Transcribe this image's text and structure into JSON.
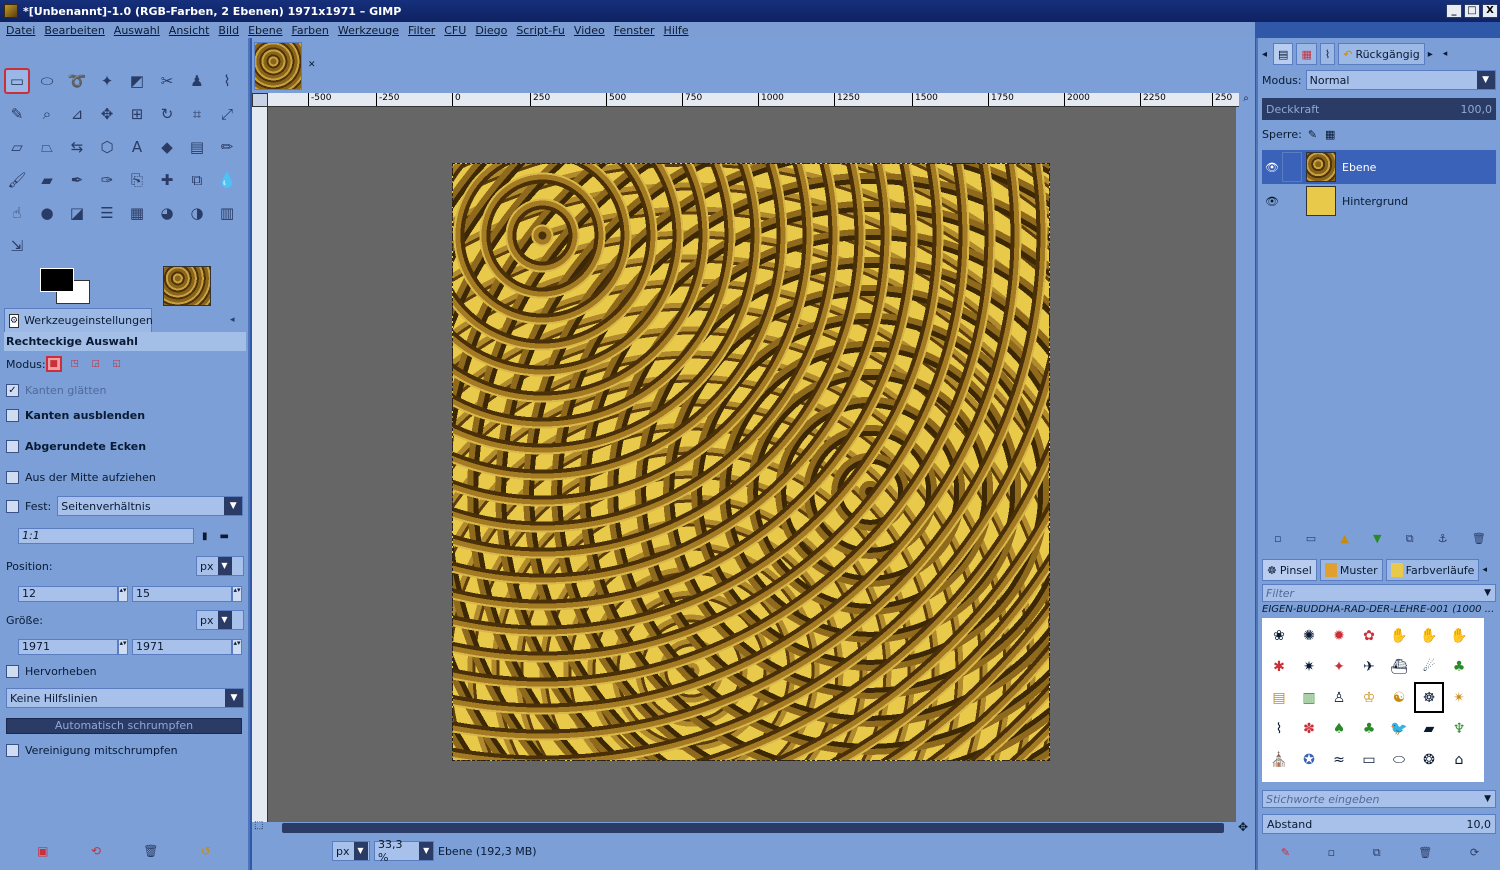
{
  "window": {
    "title": "*[Unbenannt]-1.0 (RGB-Farben, 2 Ebenen) 1971x1971 – GIMP",
    "minimize": "_",
    "maximize": "□",
    "close": "X"
  },
  "menu": [
    "Datei",
    "Bearbeiten",
    "Auswahl",
    "Ansicht",
    "Bild",
    "Ebene",
    "Farben",
    "Werkzeuge",
    "Filter",
    "CFU",
    "Diego",
    "Script-Fu",
    "Video",
    "Fenster",
    "Hilfe"
  ],
  "tool_options": {
    "tab_label": "Werkzeugeinstellungen",
    "tool_name": "Rechteckige Auswahl",
    "mode_label": "Modus:",
    "antialias": {
      "label": "Kanten glätten",
      "checked": true
    },
    "feather": {
      "label": "Kanten ausblenden",
      "checked": false
    },
    "rounded": {
      "label": "Abgerundete Ecken",
      "checked": false
    },
    "from_center": {
      "label": "Aus der Mitte aufziehen",
      "checked": false
    },
    "fixed": {
      "label": "Fest:",
      "value": "Seitenverhältnis",
      "checked": false
    },
    "ratio_value": "1:1",
    "position": {
      "label": "Position:",
      "unit": "px",
      "x": "12",
      "y": "15"
    },
    "size": {
      "label": "Größe:",
      "unit": "px",
      "w": "1971",
      "h": "1971"
    },
    "highlight": {
      "label": "Hervorheben",
      "checked": false
    },
    "guides": "Keine Hilfslinien",
    "auto_shrink": "Automatisch schrumpfen",
    "shrink_merged": {
      "label": "Vereinigung mitschrumpfen",
      "checked": false
    }
  },
  "ruler_ticks": [
    "-500",
    "-250",
    "0",
    "250",
    "500",
    "750",
    "1000",
    "1250",
    "1500",
    "1750",
    "2000",
    "2250",
    "250"
  ],
  "status": {
    "unit": "px",
    "zoom": "33,3 %",
    "info": "Ebene (192,3 MB)"
  },
  "layers_panel": {
    "undo_tab": "Rückgängig",
    "mode_label": "Modus:",
    "mode_value": "Normal",
    "opacity_label": "Deckkraft",
    "opacity_value": "100,0",
    "lock_label": "Sperre:",
    "layers": [
      {
        "name": "Ebene",
        "selected": true
      },
      {
        "name": "Hintergrund",
        "selected": false
      }
    ]
  },
  "brushes_panel": {
    "tab_brushes": "Pinsel",
    "tab_patterns": "Muster",
    "tab_gradients": "Farbverläufe",
    "filter_placeholder": "Filter",
    "selected_brush": "EIGEN-BUDDHA-RAD-DER-LEHRE-001 (1000 ...",
    "tags_placeholder": "Stichworte eingeben",
    "spacing_label": "Abstand",
    "spacing_value": "10,0"
  },
  "colors": {
    "foreground": "#000000",
    "background": "#ffffff",
    "accent": "#c9303a"
  }
}
